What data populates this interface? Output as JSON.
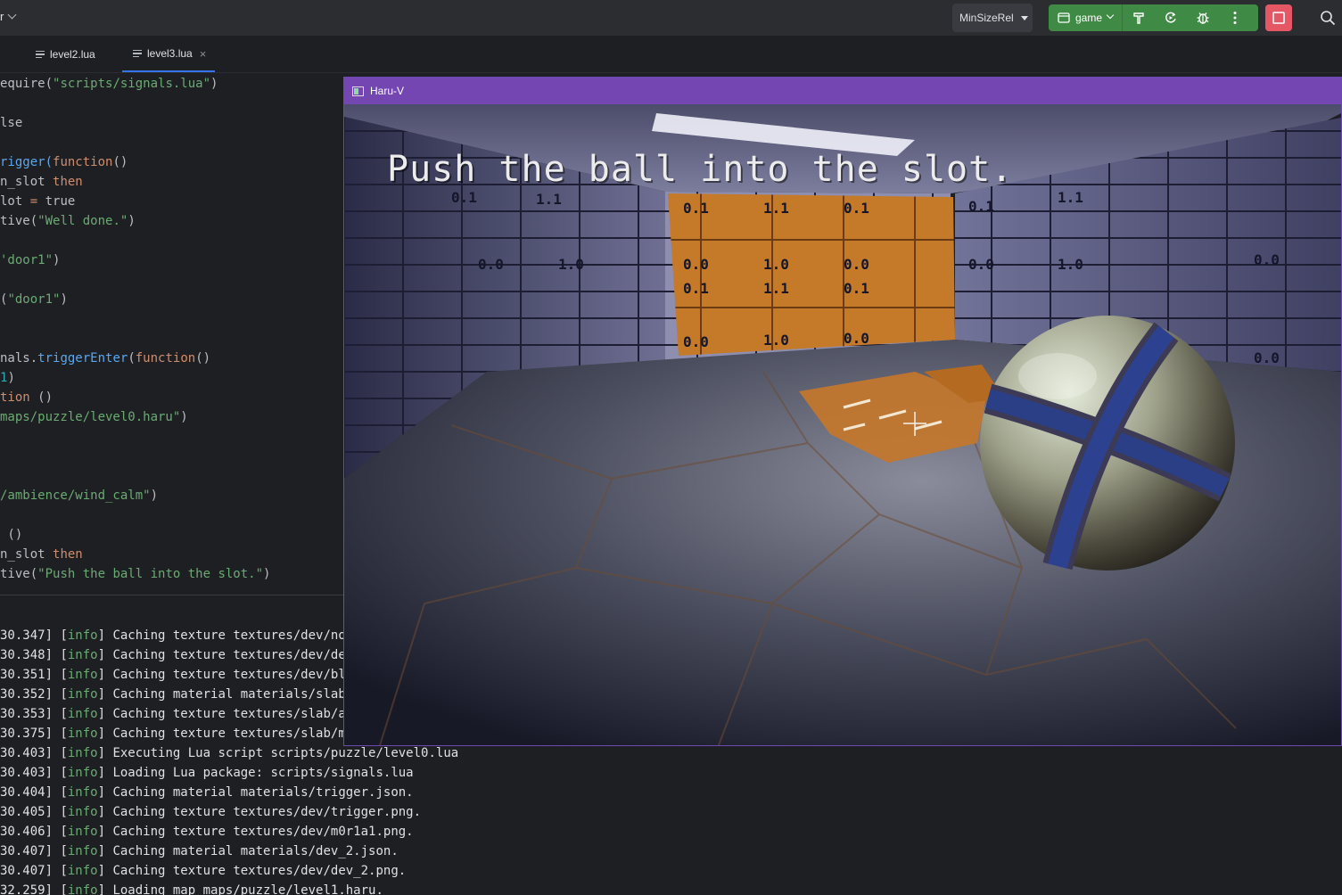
{
  "titlebar": {
    "project_fragment": "r"
  },
  "toolbar": {
    "config_label": "MinSizeRel",
    "run_target_label": "game"
  },
  "tabs": [
    {
      "label": "level2.lua"
    },
    {
      "label": "level3.lua",
      "close": "×"
    }
  ],
  "code": {
    "l1a": "equire(",
    "l1b": "\"scripts/signals.lua\"",
    "l1c": ")",
    "l3": "lse",
    "l5a": "rigger(",
    "l5b": "function",
    "l5c": "()",
    "l6a": "n_slot ",
    "l6b": "then",
    "l7a": "lot ",
    "l7b": "=",
    "l7c": " true",
    "l8a": "tive(",
    "l8b": "\"Well done.\"",
    "l8c": ")",
    "l10a": "'door1\"",
    "l10b": ")",
    "l12a": "(",
    "l12b": "\"door1\"",
    "l12c": ")",
    "l15a": "nals.",
    "l15b": "triggerEnter",
    "l15c": "(",
    "l15d": "function",
    "l15e": "()",
    "l16a": "1",
    "l16b": ")",
    "l17a": "tion",
    "l17b": " ()",
    "l18a": "maps/puzzle/level0.haru\"",
    "l18b": ")",
    "l22a": "/ambience/wind_calm\"",
    "l22b": ")",
    "l24": " ()",
    "l25a": "n_slot ",
    "l25b": "then",
    "l26a": "tive(",
    "l26b": "\"Push the ball into the slot.\"",
    "l26c": ")"
  },
  "log": [
    {
      "time": "30.347]",
      "level": "info",
      "msg": "Caching texture textures/dev/norma"
    },
    {
      "time": "30.348]",
      "level": "info",
      "msg": "Caching texture textures/dev/dev_m"
    },
    {
      "time": "30.351]",
      "level": "info",
      "msg": "Caching texture textures/dev/black"
    },
    {
      "time": "30.352]",
      "level": "info",
      "msg": "Caching material materials/slab.js"
    },
    {
      "time": "30.353]",
      "level": "info",
      "msg": "Caching texture textures/slab/albe"
    },
    {
      "time": "30.375]",
      "level": "info",
      "msg": "Caching texture textures/slab/mra."
    },
    {
      "time": "30.403]",
      "level": "info",
      "msg": "Executing Lua script scripts/puzzle/level0.lua"
    },
    {
      "time": "30.403]",
      "level": "info",
      "msg": "Loading Lua package: scripts/signals.lua"
    },
    {
      "time": "30.404]",
      "level": "info",
      "msg": "Caching material materials/trigger.json."
    },
    {
      "time": "30.405]",
      "level": "info",
      "msg": "Caching texture textures/dev/trigger.png."
    },
    {
      "time": "30.406]",
      "level": "info",
      "msg": "Caching texture textures/dev/m0r1a1.png."
    },
    {
      "time": "30.407]",
      "level": "info",
      "msg": "Caching material materials/dev_2.json."
    },
    {
      "time": "30.407]",
      "level": "info",
      "msg": "Caching texture textures/dev/dev_2.png."
    },
    {
      "time": "32.259]",
      "level": "info",
      "msg": "Loading map maps/puzzle/level1.haru."
    }
  ],
  "game": {
    "window_title": "Haru-V",
    "objective": "Push the ball into the slot.",
    "wall_labels": [
      "0.1",
      "1.1",
      "0.0",
      "1.0"
    ]
  },
  "colors": {
    "accent": "#3574f0",
    "run_green": "#3f8a44",
    "stop_red": "#e55765",
    "game_title": "#7346b1",
    "wall_orange": "#c57a2a"
  }
}
